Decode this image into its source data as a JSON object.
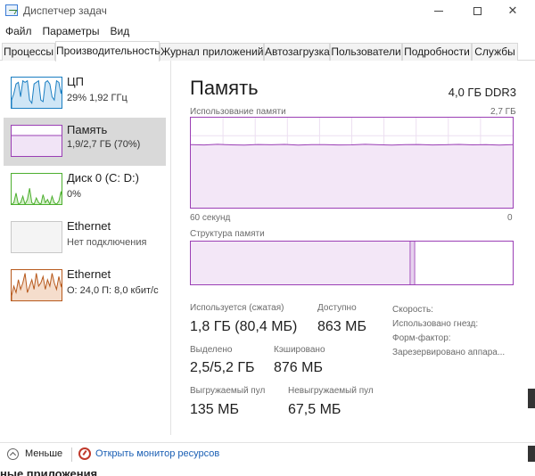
{
  "window": {
    "title": "Диспетчер задач"
  },
  "menu": {
    "items": [
      "Файл",
      "Параметры",
      "Вид"
    ]
  },
  "tabs": [
    {
      "label": "Процессы",
      "active": false
    },
    {
      "label": "Производительность",
      "active": true
    },
    {
      "label": "Журнал приложений",
      "active": false
    },
    {
      "label": "Автозагрузка",
      "active": false
    },
    {
      "label": "Пользователи",
      "active": false
    },
    {
      "label": "Подробности",
      "active": false
    },
    {
      "label": "Службы",
      "active": false
    }
  ],
  "sidebar": {
    "items": [
      {
        "name": "ЦП",
        "detail": "29%  1,92 ГГц",
        "color": "#1a7ec2"
      },
      {
        "name": "Память",
        "detail": "1,9/2,7 ГБ (70%)",
        "color": "#9b3fb5"
      },
      {
        "name": "Диск 0 (C: D:)",
        "detail": "0%",
        "color": "#4daf2f"
      },
      {
        "name": "Ethernet",
        "detail": "Нет подключения",
        "color": "#999999"
      },
      {
        "name": "Ethernet",
        "detail": "О: 24,0  П: 8,0 кбит/с",
        "color": "#b7591c"
      }
    ]
  },
  "memory": {
    "title": "Память",
    "spec": "4,0 ГБ DDR3",
    "usage_label": "Использование памяти",
    "usage_max": "2,7 ГБ",
    "time_left": "60 секунд",
    "time_right": "0",
    "structure_label": "Структура памяти",
    "usage_fraction": 0.7,
    "stats": {
      "in_use_label": "Используется (сжатая)",
      "in_use_value": "1,8 ГБ (80,4 МБ)",
      "available_label": "Доступно",
      "available_value": "863 МБ",
      "committed_label": "Выделено",
      "committed_value": "2,5/5,2 ГБ",
      "cached_label": "Кэшировано",
      "cached_value": "876 МБ",
      "paged_label": "Выгружаемый пул",
      "paged_value": "135 МБ",
      "nonpaged_label": "Невыгружаемый пул",
      "nonpaged_value": "67,5 МБ"
    },
    "info": {
      "speed": "Скорость:",
      "slots": "Использовано гнезд:",
      "form": "Форм-фактор:",
      "reserved": "Зарезервировано аппара..."
    }
  },
  "footer": {
    "less": "Меньше",
    "monitor": "Открыть монитор ресурсов"
  },
  "background_text": "ные приложения"
}
